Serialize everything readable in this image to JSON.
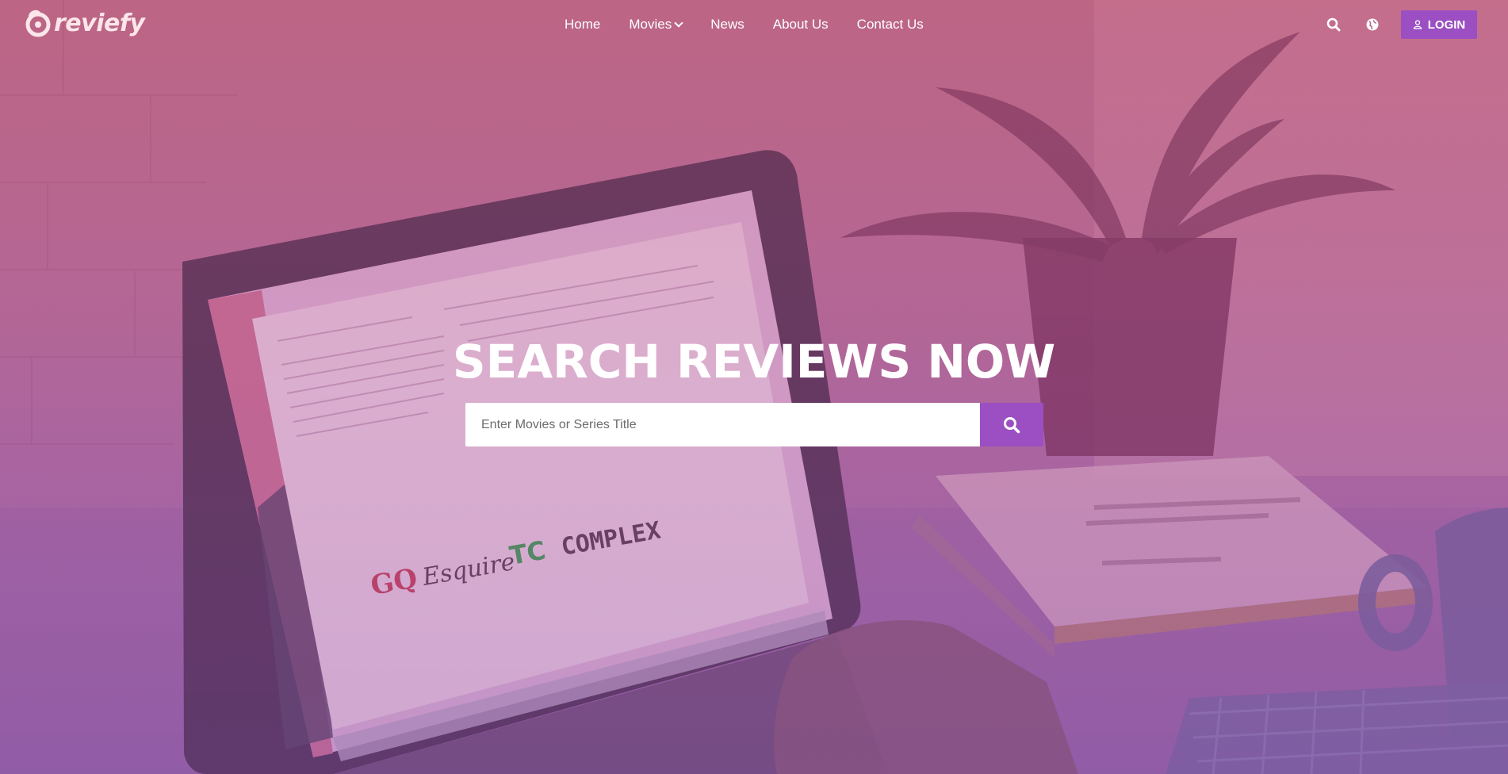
{
  "brand": {
    "name": "reviefy",
    "logo_color": "#fbe6e9"
  },
  "nav": {
    "items": [
      {
        "label": "Home"
      },
      {
        "label": "Movies",
        "has_dropdown": true
      },
      {
        "label": "News"
      },
      {
        "label": "About Us"
      },
      {
        "label": "Contact Us"
      }
    ]
  },
  "header_actions": {
    "search_icon": "search-icon",
    "language_icon": "globe-icon",
    "login_label": "LOGIN",
    "login_icon": "user-icon"
  },
  "hero": {
    "title": "SEARCH REVIEWS NOW",
    "search_placeholder": "Enter Movies or Series Title",
    "search_value": "",
    "search_button_icon": "search-icon"
  },
  "colors": {
    "accent": "#9b4fc2",
    "overlay_top": "#b86a86",
    "overlay_bottom": "#9160a6",
    "text_light": "#ffffff"
  }
}
